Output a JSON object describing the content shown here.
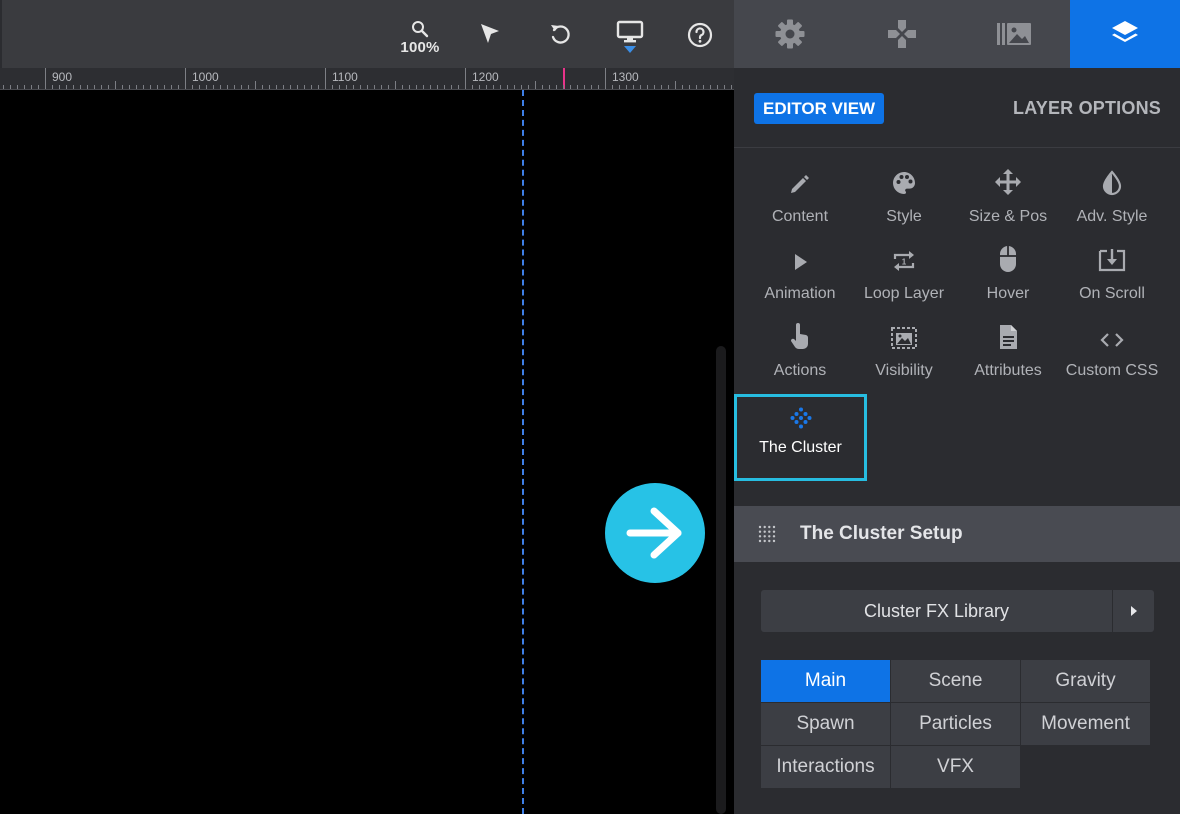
{
  "toolbar": {
    "zoom_value": "100%",
    "icons": [
      "zoom-icon",
      "select-arrow-icon",
      "undo-icon",
      "desktop-icon",
      "help-icon"
    ]
  },
  "tabs": {
    "icons": [
      "gear-icon",
      "gamepad-icon",
      "media-library-icon",
      "layers-icon"
    ],
    "active_index": 3
  },
  "ruler": {
    "labels": [
      "900",
      "1000",
      "1100",
      "1200",
      "1300"
    ]
  },
  "panel": {
    "editor_view_label": "EDITOR VIEW",
    "layer_options_label": "LAYER OPTIONS",
    "options": [
      {
        "label": "Content",
        "icon": "pencil-icon"
      },
      {
        "label": "Style",
        "icon": "palette-icon"
      },
      {
        "label": "Size & Pos",
        "icon": "move-icon"
      },
      {
        "label": "Adv. Style",
        "icon": "contrast-icon"
      },
      {
        "label": "Animation",
        "icon": "play-icon"
      },
      {
        "label": "Loop Layer",
        "icon": "loop-icon"
      },
      {
        "label": "Hover",
        "icon": "mouse-icon"
      },
      {
        "label": "On Scroll",
        "icon": "scroll-download-icon"
      },
      {
        "label": "Actions",
        "icon": "hand-pointer-icon"
      },
      {
        "label": "Visibility",
        "icon": "visibility-icon"
      },
      {
        "label": "Attributes",
        "icon": "document-icon"
      },
      {
        "label": "Custom CSS",
        "icon": "code-icon"
      },
      {
        "label": "The Cluster",
        "icon": "cluster-icon",
        "selected": true
      }
    ],
    "setup": {
      "title": "The Cluster Setup",
      "library_label": "Cluster FX Library",
      "subtabs": [
        "Main",
        "Scene",
        "Gravity",
        "Spawn",
        "Particles",
        "Movement",
        "Interactions",
        "VFX"
      ],
      "active_subtab": "Main"
    }
  },
  "colors": {
    "accent": "#0e73e6",
    "highlight": "#27bde0",
    "arrow_circle": "#27c2e6",
    "ruler_cursor": "#e8338a"
  }
}
